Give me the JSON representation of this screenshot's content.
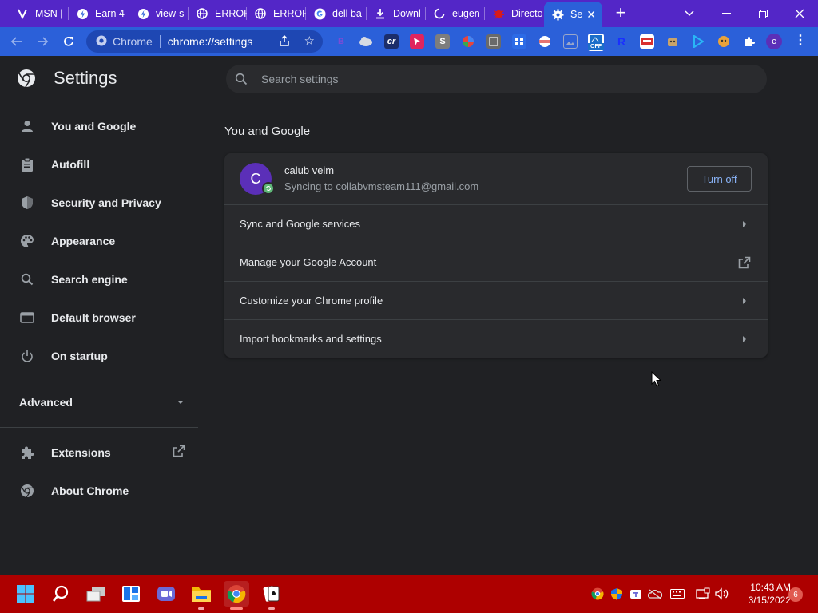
{
  "browser": {
    "tabs": [
      {
        "title": "MSN |",
        "icon": "msn-icon"
      },
      {
        "title": "Earn 4",
        "icon": "swagbucks-icon"
      },
      {
        "title": "view-s",
        "icon": "swagbucks-icon"
      },
      {
        "title": "ERROR",
        "icon": "globe-icon"
      },
      {
        "title": "ERROR",
        "icon": "globe-icon"
      },
      {
        "title": "dell ba",
        "icon": "google-icon"
      },
      {
        "title": "Downl",
        "icon": "download-icon"
      },
      {
        "title": "eugen",
        "icon": "loading-icon"
      },
      {
        "title": "Directo",
        "icon": "bug-icon"
      },
      {
        "title": "Se",
        "icon": "gear-icon",
        "active": true
      }
    ],
    "omnibox": {
      "site_label": "Chrome",
      "url": "chrome://settings"
    },
    "extensions": [
      "b-icon",
      "cloud-icon",
      "cr-icon",
      "pointer-icon",
      "s-icon",
      "puzzle-box-icon",
      "gradient-icon",
      "grid-icon",
      "flag-icon",
      "image-icon",
      "off-icon",
      "r-icon",
      "card-icon",
      "dog-icon",
      "play-icon",
      "monkey-icon",
      "extensions-puzzle-icon"
    ],
    "off_badge": "OFF",
    "ext_r_label": "R",
    "ext_cr_label": "cr",
    "ext_b_label": "B",
    "ext_s_label": "S",
    "profile_initial": "c"
  },
  "settings": {
    "title": "Settings",
    "search_placeholder": "Search settings",
    "sidebar": [
      {
        "label": "You and Google",
        "icon": "person-icon"
      },
      {
        "label": "Autofill",
        "icon": "clipboard-icon"
      },
      {
        "label": "Security and Privacy",
        "icon": "shield-icon"
      },
      {
        "label": "Appearance",
        "icon": "palette-icon"
      },
      {
        "label": "Search engine",
        "icon": "search-icon"
      },
      {
        "label": "Default browser",
        "icon": "browser-icon"
      },
      {
        "label": "On startup",
        "icon": "power-icon"
      }
    ],
    "advanced_label": "Advanced",
    "extensions_label": "Extensions",
    "about_label": "About Chrome",
    "section_title": "You and Google",
    "profile": {
      "initial": "C",
      "name": "calub veim",
      "sync_status": "Syncing to collabvmsteam111@gmail.com",
      "turn_off_label": "Turn off"
    },
    "rows": [
      {
        "label": "Sync and Google services",
        "trailing": "arrow"
      },
      {
        "label": "Manage your Google Account",
        "trailing": "external"
      },
      {
        "label": "Customize your Chrome profile",
        "trailing": "arrow"
      },
      {
        "label": "Import bookmarks and settings",
        "trailing": "arrow"
      }
    ]
  },
  "taskbar": {
    "apps": [
      "start-icon",
      "search-icon",
      "task-view-icon",
      "widgets-icon",
      "teams-chat-icon",
      "file-explorer-icon",
      "chrome-icon",
      "solitaire-icon"
    ],
    "time": "10:43 AM",
    "date": "3/15/2022",
    "notifications": "6"
  }
}
